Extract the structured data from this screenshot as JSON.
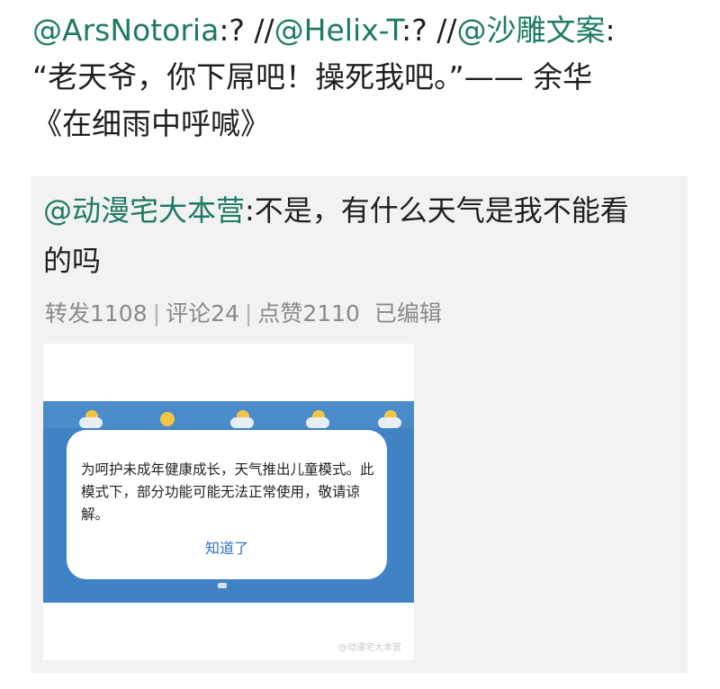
{
  "post": {
    "mention1": "@ArsNotoria",
    "text1": ":? //",
    "mention2": "@Helix-T",
    "text2": ":? //",
    "mention3": "@沙雕文案",
    "text3": ":",
    "quote": "“老天爷，你下屌吧！操死我吧。”—— 余华",
    "source": "《在细雨中呼喊》"
  },
  "repost": {
    "mention": "@动漫宅大本营",
    "text_line1": ":不是，有什么天气是我不能看",
    "text_line2": "的吗",
    "meta": {
      "reposts": "转发1108",
      "comments": "评论24",
      "likes": "点赞2110",
      "edited": "已编辑",
      "separator": "|"
    },
    "image": {
      "dialog_message": "为呵护未成年健康成长，天气推出儿童模式。此模式下，部分功能可能无法正常使用，敬请谅解。",
      "dialog_button": "知道了",
      "watermark": "@动漫宅大本营",
      "band_color": "#3f83c4",
      "weather_icons": [
        "partly-cloudy-icon",
        "sun-icon",
        "partly-cloudy-icon",
        "partly-cloudy-icon",
        "partly-cloudy-icon"
      ]
    }
  },
  "colors": {
    "mention": "#1e7a66",
    "meta": "#8a8a8a",
    "link_button": "#2f6fc9"
  }
}
